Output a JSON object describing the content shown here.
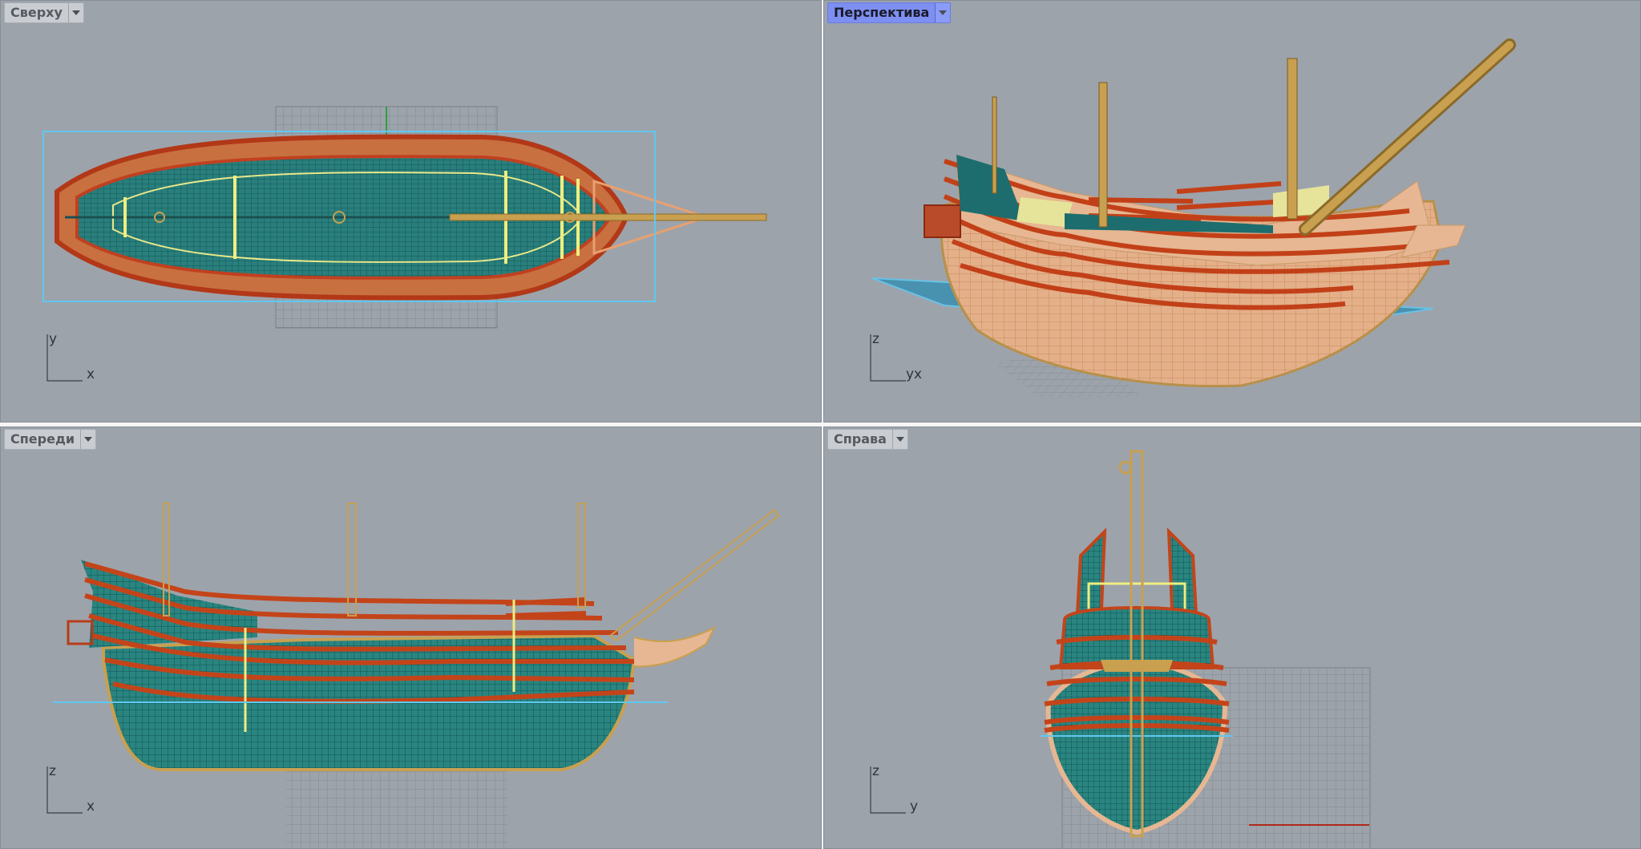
{
  "viewports": {
    "top": {
      "title": "Сверху",
      "axis_vertical": "y",
      "axis_horizontal": "x"
    },
    "perspective": {
      "title": "Перспектива",
      "axis_vertical": "z",
      "axis_horizontal": "yx"
    },
    "front": {
      "title": "Спереди",
      "axis_vertical": "z",
      "axis_horizontal": "x"
    },
    "right": {
      "title": "Справа",
      "axis_vertical": "z",
      "axis_horizontal": "y"
    }
  },
  "active_viewport": "perspective",
  "colors": {
    "viewport_bg": "#9da3ab",
    "active_tab": "#7d8ff0",
    "hull_wire": "#e8a070",
    "red_rails": "#c0401c",
    "teal_wire": "#1a7272",
    "yellow_highlight": "#f0f080",
    "mast_tan": "#c8a050",
    "selection_box": "#5fc8f0",
    "grid": "#80868e"
  },
  "icons": [
    "dropdown-arrow-icon",
    "axis-gizmo-icon"
  ]
}
